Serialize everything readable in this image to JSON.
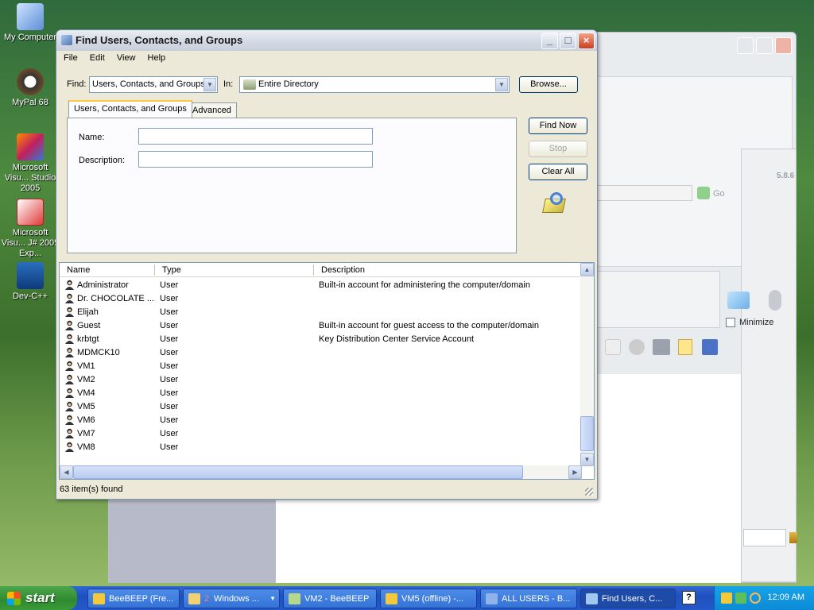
{
  "desktop": {
    "icons": [
      {
        "label": "My Computer"
      },
      {
        "label": "MyPal 68"
      },
      {
        "label": "Microsoft Visu... Studio 2005"
      },
      {
        "label": "Microsoft Visu... J# 2005 Exp..."
      },
      {
        "label": "Dev-C++"
      }
    ]
  },
  "background": {
    "version": "5.8.6",
    "go_label": "Go",
    "minimize_label": "Minimize"
  },
  "window": {
    "title": "Find Users, Contacts, and Groups",
    "menu": [
      "File",
      "Edit",
      "View",
      "Help"
    ],
    "find_label": "Find:",
    "find_value": "Users, Contacts, and Groups",
    "in_label": "In:",
    "in_value": "Entire Directory",
    "browse_label": "Browse...",
    "tabs": [
      "Users, Contacts, and Groups",
      "Advanced"
    ],
    "name_label": "Name:",
    "description_label": "Description:",
    "find_now_label": "Find Now",
    "stop_label": "Stop",
    "clear_all_label": "Clear All",
    "columns": [
      "Name",
      "Type",
      "Description"
    ],
    "rows": [
      {
        "name": "Administrator",
        "type": "User",
        "description": "Built-in account for administering the computer/domain"
      },
      {
        "name": "Dr. CHOCOLATE ...",
        "type": "User",
        "description": ""
      },
      {
        "name": "Elijah",
        "type": "User",
        "description": ""
      },
      {
        "name": "Guest",
        "type": "User",
        "description": "Built-in account for guest access to the computer/domain"
      },
      {
        "name": "krbtgt",
        "type": "User",
        "description": "Key Distribution Center Service Account"
      },
      {
        "name": "MDMCK10",
        "type": "User",
        "description": ""
      },
      {
        "name": "VM1",
        "type": "User",
        "description": ""
      },
      {
        "name": "VM2",
        "type": "User",
        "description": ""
      },
      {
        "name": "VM4",
        "type": "User",
        "description": ""
      },
      {
        "name": "VM5",
        "type": "User",
        "description": ""
      },
      {
        "name": "VM6",
        "type": "User",
        "description": ""
      },
      {
        "name": "VM7",
        "type": "User",
        "description": ""
      },
      {
        "name": "VM8",
        "type": "User",
        "description": ""
      }
    ],
    "status": "63 item(s) found"
  },
  "taskbar": {
    "start_label": "start",
    "tasks": [
      {
        "label": "BeeBEEP (Fre..."
      },
      {
        "label": "Windows ...",
        "count": "2"
      },
      {
        "label": "VM2 - BeeBEEP"
      },
      {
        "label": "VM5 (offline) -..."
      },
      {
        "label": "ALL USERS - B..."
      },
      {
        "label": "Find Users, C..."
      }
    ],
    "clock": "12:09 AM"
  },
  "colors": {
    "accent": "#245edb",
    "tab_highlight": "#ffc83c",
    "start_green": "#3a9b3a"
  }
}
